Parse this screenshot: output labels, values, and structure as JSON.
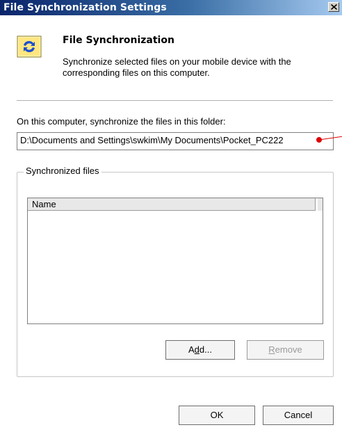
{
  "window": {
    "title": "File Synchronization Settings"
  },
  "header": {
    "title": "File Synchronization",
    "description": "Synchronize selected files on your mobile device with the corresponding files on this computer.",
    "icon": "sync-arrows-icon"
  },
  "folder": {
    "label": "On this computer, synchronize the files in this folder:",
    "path": "D:\\Documents and Settings\\swkim\\My Documents\\Pocket_PC222"
  },
  "files_group": {
    "legend": "Synchronized files",
    "column_name": "Name",
    "rows": []
  },
  "buttons": {
    "add_pre": "A",
    "add_mnemonic": "d",
    "add_post": "d...",
    "remove_mnemonic": "R",
    "remove_post": "emove",
    "ok": "OK",
    "cancel": "Cancel"
  },
  "colors": {
    "title_gradient_start": "#0a246a",
    "title_gradient_end": "#a6caf0",
    "callout_red": "#e00000"
  }
}
